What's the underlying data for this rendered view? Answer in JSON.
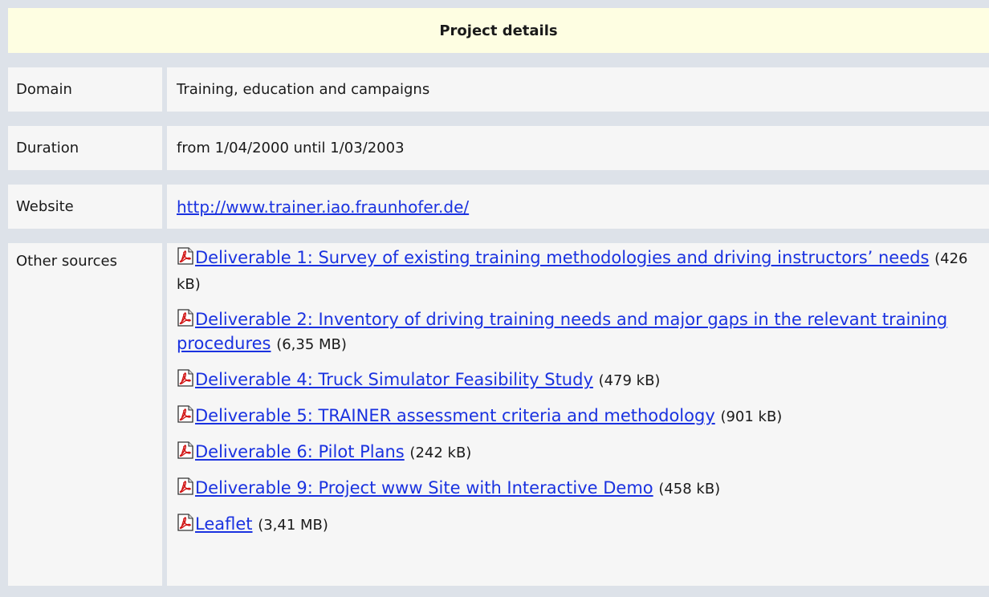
{
  "header": {
    "title": "Project details"
  },
  "domain": {
    "label": "Domain",
    "value": "Training, education and campaigns"
  },
  "duration": {
    "label": "Duration",
    "value": "from 1/04/2000 until 1/03/2003"
  },
  "website": {
    "label": "Website",
    "url": "http://www.trainer.iao.fraunhofer.de/"
  },
  "sources": {
    "label": "Other sources",
    "icon": "pdf-icon",
    "items": [
      {
        "title": "Deliverable 1: Survey of existing training methodologies and driving instructors’ needs",
        "size": "(426 kB)"
      },
      {
        "title": "Deliverable 2: Inventory of driving training needs and major gaps in the relevant training procedures",
        "size": "(6,35 MB)"
      },
      {
        "title": "Deliverable 4: Truck Simulator Feasibility Study",
        "size": "(479 kB)"
      },
      {
        "title": "Deliverable 5: TRAINER assessment criteria and methodology",
        "size": "(901 kB)"
      },
      {
        "title": "Deliverable 6: Pilot Plans",
        "size": "(242 kB)"
      },
      {
        "title": "Deliverable 9: Project www Site with Interactive Demo",
        "size": "(458 kB)"
      },
      {
        "title": "Leaflet",
        "size": "(3,41 MB)"
      }
    ]
  },
  "colors": {
    "link": "#1a32e0",
    "header_bg": "#fefee2",
    "cell_bg": "#f6f6f6",
    "border": "#dde2e9"
  }
}
